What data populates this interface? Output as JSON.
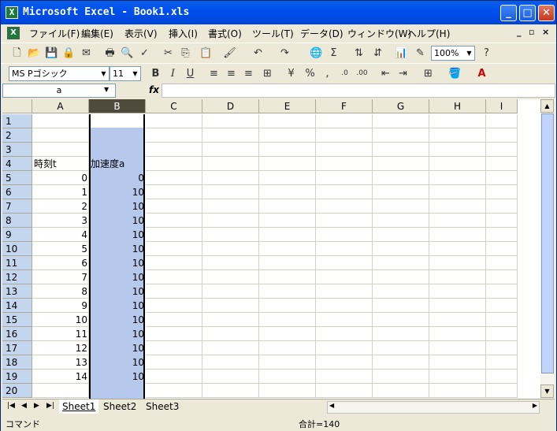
{
  "window": {
    "title": "Microsoft Excel - Book1.xls",
    "icon": "X"
  },
  "menu": [
    "ファイル(F)",
    "編集(E)",
    "表示(V)",
    "挿入(I)",
    "書式(O)",
    "ツール(T)",
    "データ(D)",
    "ウィンドウ(W)",
    "ヘルプ(H)"
  ],
  "toolbar": {
    "zoom": "100%"
  },
  "format": {
    "font": "MS Pゴシック",
    "size": "11",
    "bold": "B",
    "italic": "I",
    "underline": "U"
  },
  "formula": {
    "namebox": "a",
    "fx": "fx",
    "content": ""
  },
  "columns": [
    "A",
    "B",
    "C",
    "D",
    "E",
    "F",
    "G",
    "H",
    "I"
  ],
  "rows": [
    "1",
    "2",
    "3",
    "4",
    "5",
    "6",
    "7",
    "8",
    "9",
    "10",
    "11",
    "12",
    "13",
    "14",
    "15",
    "16",
    "17",
    "18",
    "19",
    "20"
  ],
  "cells": {
    "A4": "時刻t",
    "B4": "加速度a",
    "A": [
      "0",
      "1",
      "2",
      "3",
      "4",
      "5",
      "6",
      "7",
      "8",
      "9",
      "10",
      "11",
      "12",
      "13",
      "14"
    ],
    "B": [
      "0",
      "10",
      "10",
      "10",
      "10",
      "10",
      "10",
      "10",
      "10",
      "10",
      "10",
      "10",
      "10",
      "10",
      "10"
    ]
  },
  "sheets": [
    "Sheet1",
    "Sheet2",
    "Sheet3"
  ],
  "status": {
    "mode": "コマンド",
    "sum": "合計=140"
  }
}
